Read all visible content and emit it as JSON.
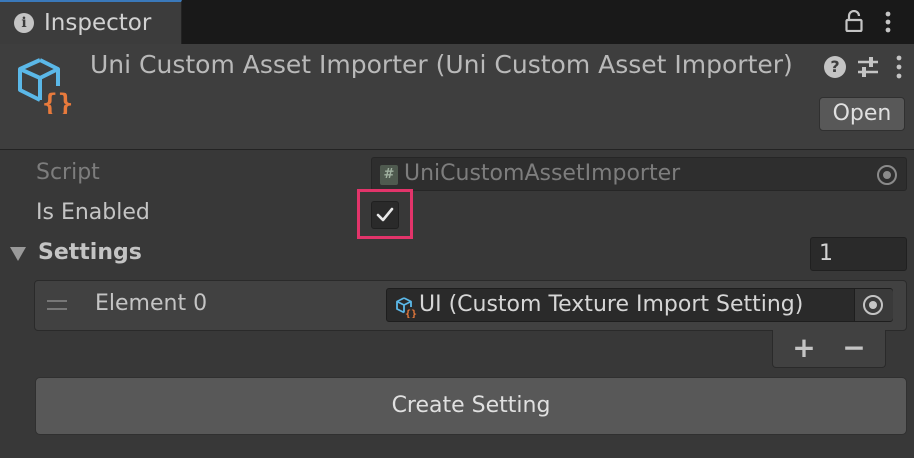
{
  "tab": {
    "title": "Inspector"
  },
  "header": {
    "title": "Uni Custom Asset Importer (Uni Custom Asset Importer)",
    "open_label": "Open"
  },
  "fields": {
    "script_label": "Script",
    "script_value": "UniCustomAssetImporter",
    "is_enabled_label": "Is Enabled",
    "is_enabled_checked": true,
    "settings_label": "Settings",
    "settings_count": "1"
  },
  "settings_list": {
    "items": [
      {
        "label": "Element 0",
        "value": "UI (Custom Texture Import Setting)"
      }
    ],
    "add_label": "+",
    "remove_label": "−"
  },
  "create_button_label": "Create Setting",
  "colors": {
    "highlight": "#e2346a",
    "icon_blue": "#5bb8e8",
    "icon_orange": "#e87a3c"
  },
  "icons": [
    "info-icon",
    "lock-icon",
    "kebab-menu-icon",
    "help-icon",
    "preset-icon",
    "asset-importer-icon",
    "script-hash-icon",
    "object-picker-icon",
    "checkmark-icon",
    "foldout-arrow-icon",
    "drag-handle-icon"
  ]
}
